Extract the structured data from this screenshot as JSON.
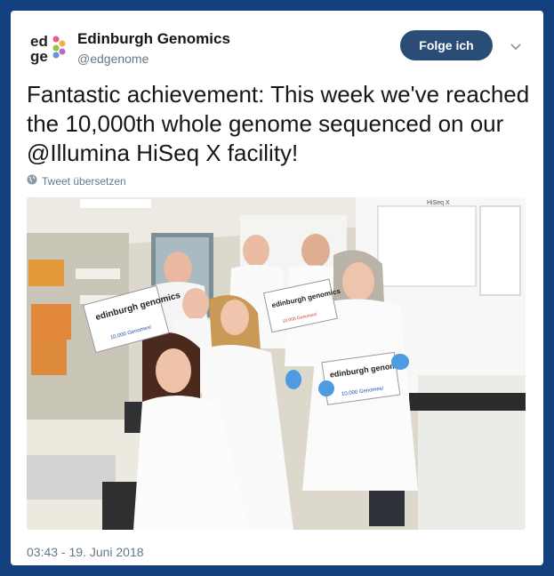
{
  "tweet": {
    "author_name": "Edinburgh Genomics",
    "author_handle": "@edgenome",
    "avatar_text_line1": "ed",
    "avatar_text_line2": "ge",
    "follow_label": "Folge ich",
    "text": "Fantastic achievement: This week we've reached the 10,000th whole genome sequenced on our @Illumina HiSeq X facility!",
    "translate_label": "Tweet übersetzen",
    "timestamp": "03:43 - 19. Juni 2018"
  },
  "photo": {
    "sign_title_1": "edinburgh genomics",
    "sign_sub": "10,000 Genomes!",
    "machine_label": "HiSeq X"
  },
  "colors": {
    "background": "#13407e",
    "follow_button": "#2a4d78",
    "text": "#14171a",
    "muted": "#657786"
  },
  "icons": [
    "globe-icon",
    "chevron-down-icon"
  ]
}
